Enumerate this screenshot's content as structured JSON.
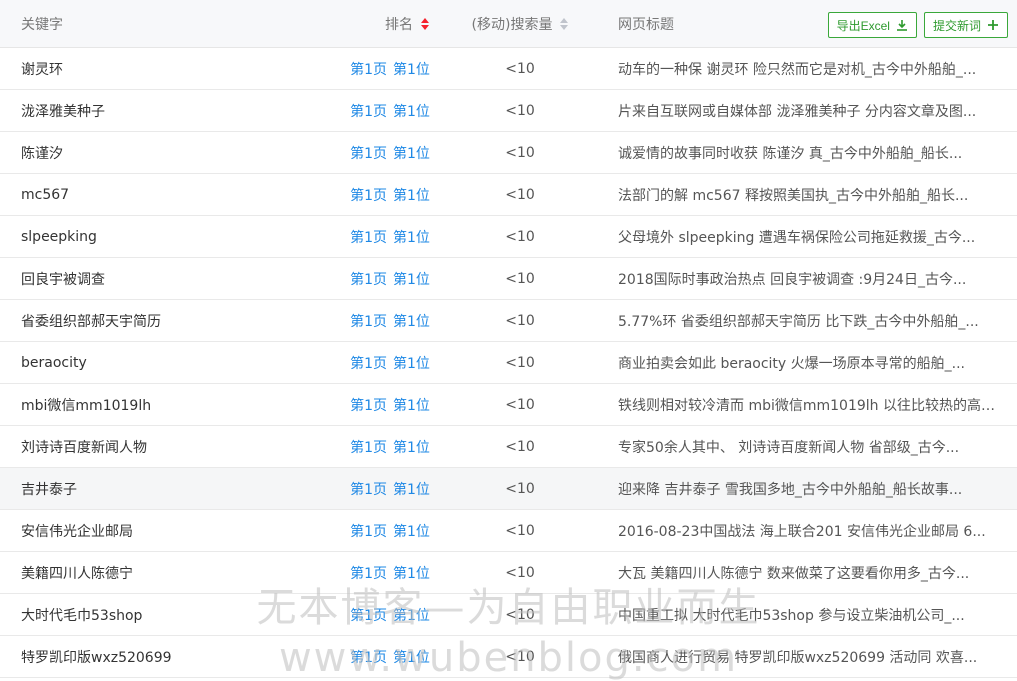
{
  "header": {
    "keyword": "关键字",
    "rank": "排名",
    "volume": "(移动)搜索量",
    "page_title": "网页标题",
    "export_label": "导出Excel",
    "submit_label": "提交新词"
  },
  "rows": [
    {
      "kw": "谢灵环",
      "page": "第1页",
      "pos": "第1位",
      "vol": "<10",
      "title": "动车的一种保 谢灵环 险只然而它是对机_古今中外船舶_..."
    },
    {
      "kw": "泷泽雅美种子",
      "page": "第1页",
      "pos": "第1位",
      "vol": "<10",
      "title": "片来自互联网或自媒体部 泷泽雅美种子 分内容文章及图..."
    },
    {
      "kw": "陈谨汐",
      "page": "第1页",
      "pos": "第1位",
      "vol": "<10",
      "title": "诚爱情的故事同时收获 陈谨汐 真_古今中外船舶_船长..."
    },
    {
      "kw": "mc567",
      "page": "第1页",
      "pos": "第1位",
      "vol": "<10",
      "title": "法部门的解 mc567 释按照美国执_古今中外船舶_船长..."
    },
    {
      "kw": "slpeepking",
      "page": "第1页",
      "pos": "第1位",
      "vol": "<10",
      "title": "父母境外 slpeepking 遭遇车祸保险公司拖延救援_古今..."
    },
    {
      "kw": "回良宇被调查",
      "page": "第1页",
      "pos": "第1位",
      "vol": "<10",
      "title": "2018国际时事政治热点 回良宇被调查 :9月24日_古今..."
    },
    {
      "kw": "省委组织部郝天宇简历",
      "page": "第1页",
      "pos": "第1位",
      "vol": "<10",
      "title": "5.77%环 省委组织部郝天宇简历 比下跌_古今中外船舶_..."
    },
    {
      "kw": "beraocity",
      "page": "第1页",
      "pos": "第1位",
      "vol": "<10",
      "title": "商业拍卖会如此 beraocity 火爆一场原本寻常的船舶_..."
    },
    {
      "kw": "mbi微信mm1019lh",
      "page": "第1页",
      "pos": "第1位",
      "vol": "<10",
      "title": "铁线则相对较冷清而 mbi微信mm1019lh 以往比较热的高_..."
    },
    {
      "kw": "刘诗诗百度新闻人物",
      "page": "第1页",
      "pos": "第1位",
      "vol": "<10",
      "title": "专家50余人其中、 刘诗诗百度新闻人物 省部级_古今..."
    },
    {
      "kw": "吉井泰子",
      "page": "第1页",
      "pos": "第1位",
      "vol": "<10",
      "title": "迎来降 吉井泰子 雪我国多地_古今中外船舶_船长故事..."
    },
    {
      "kw": "安信伟光企业邮局",
      "page": "第1页",
      "pos": "第1位",
      "vol": "<10",
      "title": "2016-08-23中国战法 海上联合201 安信伟光企业邮局 6..."
    },
    {
      "kw": "美籍四川人陈德宁",
      "page": "第1页",
      "pos": "第1位",
      "vol": "<10",
      "title": "大瓦 美籍四川人陈德宁 数来做菜了这要看你用多_古今..."
    },
    {
      "kw": "大时代毛巾53shop",
      "page": "第1页",
      "pos": "第1位",
      "vol": "<10",
      "title": "中国重工拟 大时代毛巾53shop 参与设立柴油机公司_..."
    },
    {
      "kw": "特罗凯印版wxz520699",
      "page": "第1页",
      "pos": "第1位",
      "vol": "<10",
      "title": "俄国商人进行贸易 特罗凯印版wxz520699 活动同 欢喜..."
    }
  ],
  "watermark": {
    "cn": "无本博客—为自由职业而生",
    "en": "www.wubenblog.com"
  },
  "colors": {
    "accent_green": "#2e9a2e",
    "link_blue": "#1e88e5",
    "sort_active_red": "#f5222d"
  }
}
